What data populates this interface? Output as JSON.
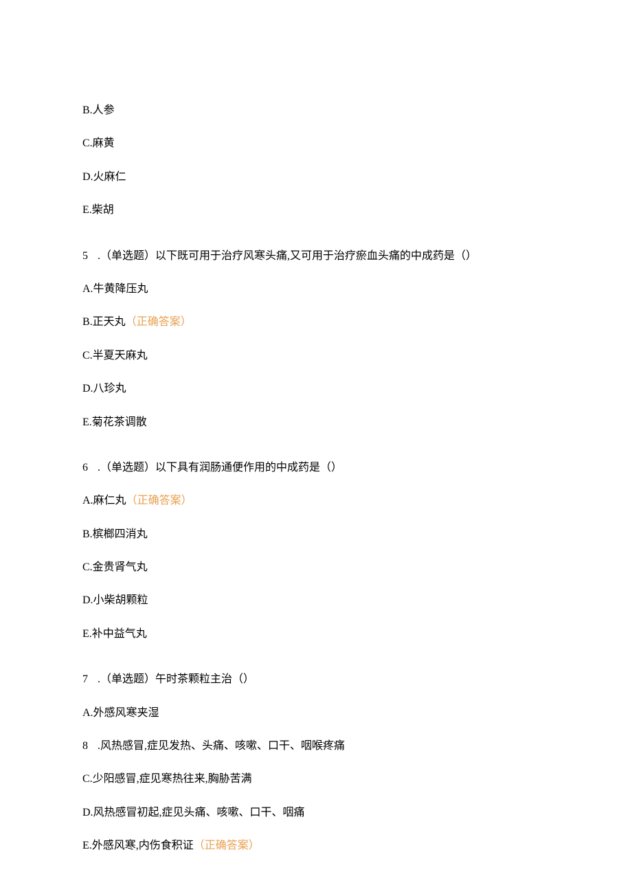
{
  "partial_options": [
    "B.人参",
    "C.麻黄",
    "D.火麻仁",
    "E.柴胡"
  ],
  "correct_label": "（正确答案）",
  "questions": [
    {
      "number": "5",
      "type": "（单选题）",
      "stem": "以下既可用于治疗风寒头痛,又可用于治疗瘀血头痛的中成药是（）",
      "options": [
        {
          "label": "A.牛黄降压丸",
          "correct": false
        },
        {
          "label": "B.正天丸",
          "correct": true
        },
        {
          "label": "C.半夏天麻丸",
          "correct": false
        },
        {
          "label": "D.八珍丸",
          "correct": false
        },
        {
          "label": "E.菊花茶调散",
          "correct": false
        }
      ]
    },
    {
      "number": "6",
      "type": "（单选题）",
      "stem": "以下具有润肠通便作用的中成药是（）",
      "options": [
        {
          "label": "A.麻仁丸",
          "correct": true
        },
        {
          "label": "B.槟榔四消丸",
          "correct": false
        },
        {
          "label": "C.金贵肾气丸",
          "correct": false
        },
        {
          "label": "D.小柴胡颗粒",
          "correct": false
        },
        {
          "label": "E.补中益气丸",
          "correct": false
        }
      ]
    },
    {
      "number": "7",
      "type": "（单选题）",
      "stem": "午时茶颗粒主治（）",
      "options": [
        {
          "label": "A.外感风寒夹湿",
          "correct": false,
          "override_number": null
        },
        {
          "label": ".风热感冒,症见发热、头痛、咳嗽、口干、咽喉疼痛",
          "correct": false,
          "override_number": "8"
        },
        {
          "label": "C.少阳感冒,症见寒热往来,胸胁苦满",
          "correct": false,
          "override_number": null
        },
        {
          "label": "D.风热感冒初起,症见头痛、咳嗽、口干、咽痛",
          "correct": false,
          "override_number": null
        },
        {
          "label": "E.外感风寒,内伤食积证",
          "correct": true,
          "override_number": null
        }
      ]
    }
  ]
}
